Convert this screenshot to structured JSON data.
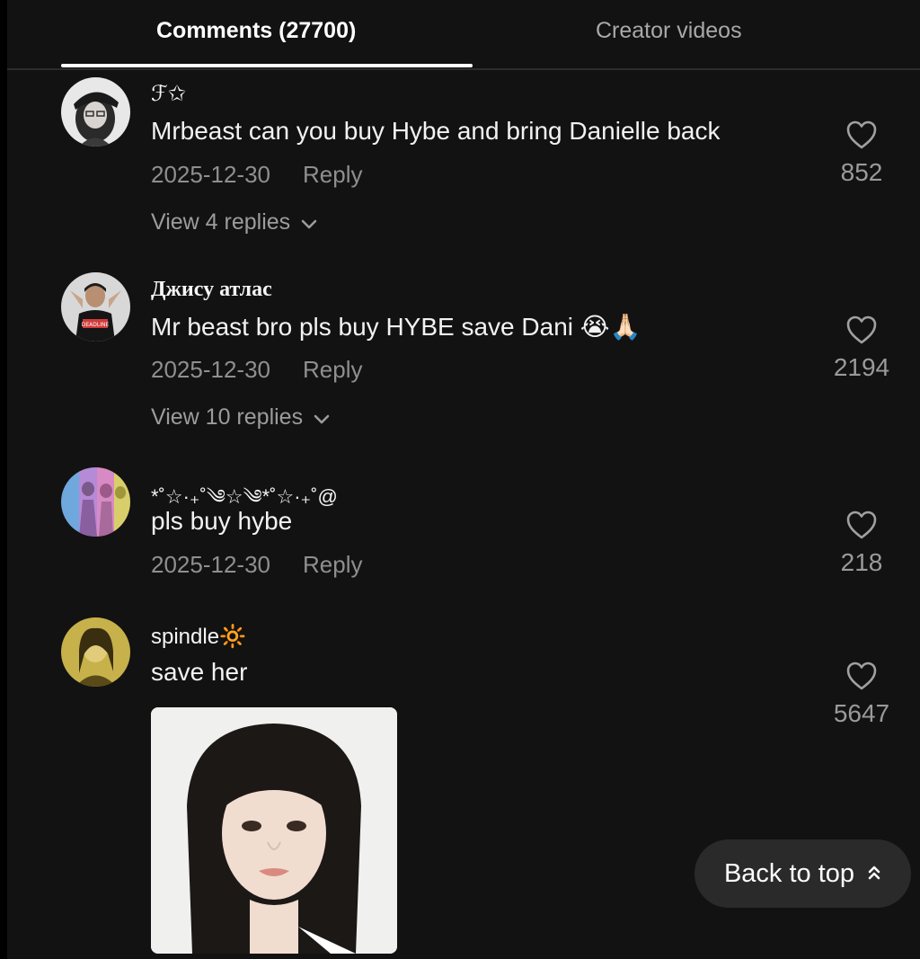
{
  "tabs": {
    "comments_label": "Comments (27700)",
    "creator_label": "Creator videos",
    "active": "comments"
  },
  "comments": [
    {
      "username": "ℱ✩",
      "text": "Mrbeast can you buy Hybe and bring Danielle back",
      "date": "2025-12-30",
      "reply_label": "Reply",
      "likes": "852",
      "view_replies": "View 4 replies"
    },
    {
      "username": "Джису атлас",
      "text": "Mr beast bro pls buy HYBE save Dani 😭🙏🏻",
      "date": "2025-12-30",
      "reply_label": "Reply",
      "likes": "2194",
      "view_replies": "View 10 replies"
    },
    {
      "username": "*˚☆·₊˚༄☆༄*˚☆·₊˚@",
      "text": "pls buy hybe",
      "date": "2025-12-30",
      "reply_label": "Reply",
      "likes": "218"
    },
    {
      "username": "spindle🔆",
      "text": "save her",
      "likes": "5647"
    }
  ],
  "back_to_top": "Back to top",
  "colors": {
    "background": "#121212",
    "text_primary": "#f2f2f2",
    "text_secondary": "#8f8f8f",
    "active_tab_indicator": "#ffffff",
    "button_bg": "#2a2a2a"
  },
  "icons": {
    "like": "heart-outline-icon",
    "expand": "chevron-down-icon",
    "back_to_top": "double-chevron-up-icon"
  }
}
